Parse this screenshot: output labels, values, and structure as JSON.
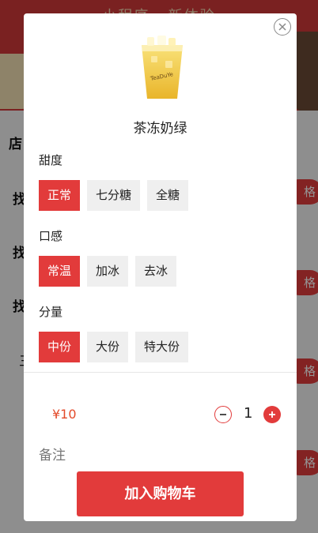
{
  "background": {
    "header_title": "小程序 · 新体验",
    "store_label": "店",
    "sidebar_items": [
      "找",
      "找",
      "找",
      "三"
    ],
    "spec_button_label": "格"
  },
  "modal": {
    "product_name": "茶冻奶绿",
    "cup_text": "TeaDuYe",
    "sections": [
      {
        "label": "甜度",
        "options": [
          "正常",
          "七分糖",
          "全糖"
        ],
        "selected": 0
      },
      {
        "label": "口感",
        "options": [
          "常温",
          "加冰",
          "去冰"
        ],
        "selected": 0
      },
      {
        "label": "分量",
        "options": [
          "中份",
          "大份",
          "特大份"
        ],
        "selected": 0
      }
    ],
    "price": "¥10",
    "quantity": "1",
    "remark_label": "备注",
    "add_to_cart_label": "加入购物车"
  },
  "colors": {
    "accent": "#e23b3b",
    "price": "#e34a2a"
  },
  "icons": {
    "close": "close-icon",
    "minus": "minus-icon",
    "plus": "plus-icon",
    "product": "milk-tea-cup-image"
  }
}
